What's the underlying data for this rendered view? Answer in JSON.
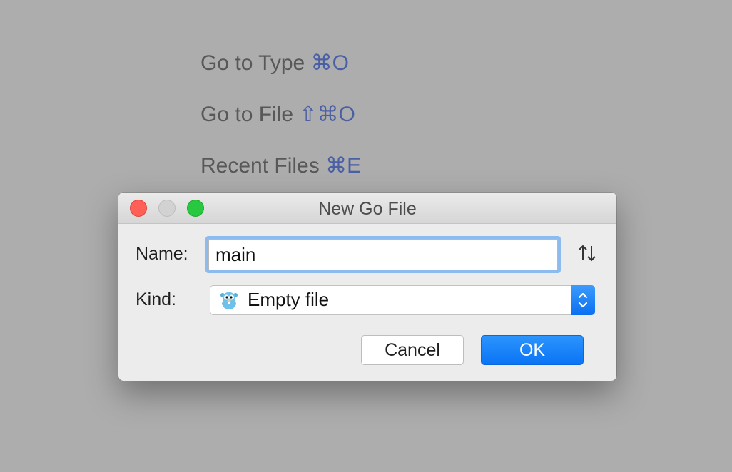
{
  "background_hints": [
    {
      "text": "Go to Type",
      "shortcut": "⌘O"
    },
    {
      "text": "Go to File",
      "shortcut": "⇧⌘O"
    },
    {
      "text": "Recent Files",
      "shortcut": "⌘E"
    }
  ],
  "dialog": {
    "title": "New Go File",
    "name_label": "Name:",
    "name_value": "main",
    "kind_label": "Kind:",
    "kind_value": "Empty file",
    "kind_icon": "gopher-icon",
    "sort_icon": "sort-up-down-icon",
    "cancel_label": "Cancel",
    "ok_label": "OK"
  },
  "colors": {
    "backdrop": "#adadad",
    "shortcut_accent": "#4a5fa4",
    "primary_button": "#0a74f5",
    "focus_ring": "#8cbbf0",
    "close": "#fe5f57",
    "minimize": "#d2d2d2",
    "zoom": "#28c840"
  }
}
